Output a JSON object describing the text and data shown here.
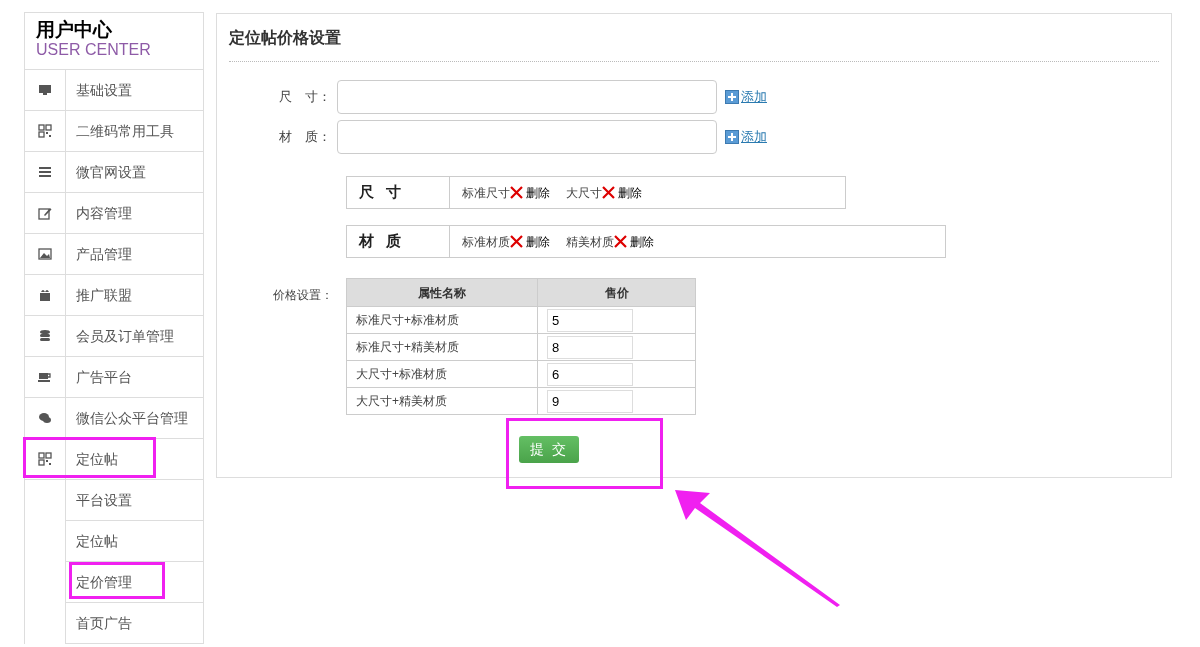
{
  "sidebar": {
    "title": "用户中心",
    "subtitle": "USER CENTER",
    "items": [
      {
        "label": "基础设置",
        "highlighted": false
      },
      {
        "label": "二维码常用工具",
        "highlighted": false
      },
      {
        "label": "微官网设置",
        "highlighted": false
      },
      {
        "label": "内容管理",
        "highlighted": false
      },
      {
        "label": "产品管理",
        "highlighted": false
      },
      {
        "label": "推广联盟",
        "highlighted": false
      },
      {
        "label": "会员及订单管理",
        "highlighted": false
      },
      {
        "label": "广告平台",
        "highlighted": false
      },
      {
        "label": "微信公众平台管理",
        "highlighted": false
      },
      {
        "label": "定位帖",
        "highlighted": true,
        "children": [
          {
            "label": "平台设置",
            "highlighted": false
          },
          {
            "label": "定位帖",
            "highlighted": false
          },
          {
            "label": "定价管理",
            "highlighted": true
          },
          {
            "label": "首页广告",
            "highlighted": false
          }
        ]
      }
    ]
  },
  "main": {
    "title": "定位帖价格设置",
    "fields": [
      {
        "label": "尺　寸：",
        "action": "添加"
      },
      {
        "label": "材　质：",
        "action": "添加"
      }
    ],
    "attribute_groups": [
      {
        "name": "尺 寸",
        "values": [
          {
            "label": "标准尺寸",
            "action": "删除"
          },
          {
            "label": "大尺寸",
            "action": "删除"
          }
        ]
      },
      {
        "name": "材 质",
        "values": [
          {
            "label": "标准材质",
            "action": "删除"
          },
          {
            "label": "精美材质",
            "action": "删除"
          }
        ]
      }
    ],
    "price": {
      "label": "价格设置：",
      "columns": [
        "属性名称",
        "售价"
      ],
      "rows": [
        {
          "name": "标准尺寸+标准材质",
          "price": "5"
        },
        {
          "name": "标准尺寸+精美材质",
          "price": "8"
        },
        {
          "name": "大尺寸+标准材质",
          "price": "6"
        },
        {
          "name": "大尺寸+精美材质",
          "price": "9"
        }
      ]
    },
    "submit": {
      "label": "提 交",
      "highlighted": true
    }
  },
  "annotation_arrow": true
}
